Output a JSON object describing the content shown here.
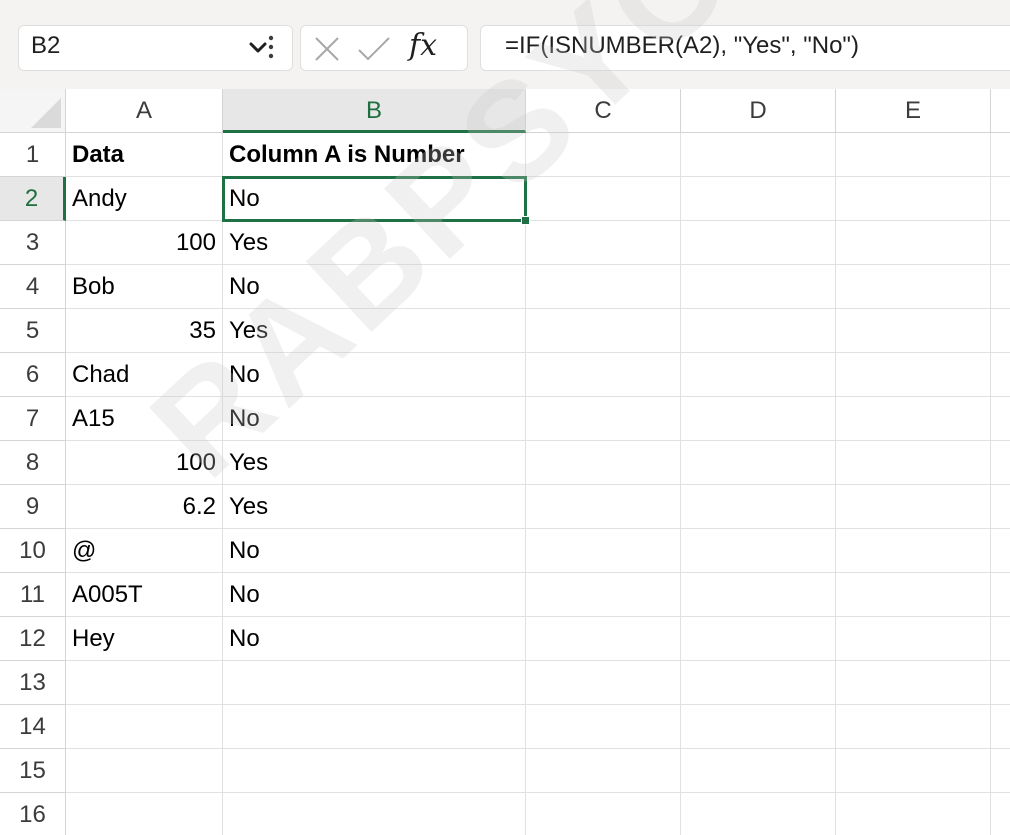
{
  "formula_bar": {
    "name_box_value": "B2",
    "formula": "=IF(ISNUMBER(A2), \"Yes\", \"No\")",
    "fx_label": "fx",
    "icons": [
      "chevron-down-icon",
      "more-options-icon",
      "cancel-icon",
      "enter-icon",
      "insert-function-icon"
    ]
  },
  "columns": [
    "A",
    "B",
    "C",
    "D",
    "E"
  ],
  "active_column": "B",
  "active_row": "2",
  "rows": [
    {
      "num": "1",
      "a": "Data",
      "b": "Column A is Number"
    },
    {
      "num": "2",
      "a": "Andy",
      "b": "No"
    },
    {
      "num": "3",
      "a": "100",
      "b": "Yes"
    },
    {
      "num": "4",
      "a": "Bob",
      "b": "No"
    },
    {
      "num": "5",
      "a": "35",
      "b": "Yes"
    },
    {
      "num": "6",
      "a": "Chad",
      "b": "No"
    },
    {
      "num": "7",
      "a": "A15",
      "b": "No"
    },
    {
      "num": "8",
      "a": "100",
      "b": "Yes"
    },
    {
      "num": "9",
      "a": "6.2",
      "b": "Yes"
    },
    {
      "num": "10",
      "a": "@",
      "b": "No"
    },
    {
      "num": "11",
      "a": "A005T",
      "b": "No"
    },
    {
      "num": "12",
      "a": "Hey",
      "b": "No"
    },
    {
      "num": "13",
      "a": "",
      "b": ""
    },
    {
      "num": "14",
      "a": "",
      "b": ""
    },
    {
      "num": "15",
      "a": "",
      "b": ""
    },
    {
      "num": "16",
      "a": "",
      "b": ""
    }
  ],
  "watermark": "RABPSYCHOLOGY.C",
  "colors": {
    "accent": "#1e7145",
    "header_active_bg": "#e7e7e7",
    "gridline": "#e1e1e1",
    "toolbar_bg": "#f4f3f2"
  }
}
